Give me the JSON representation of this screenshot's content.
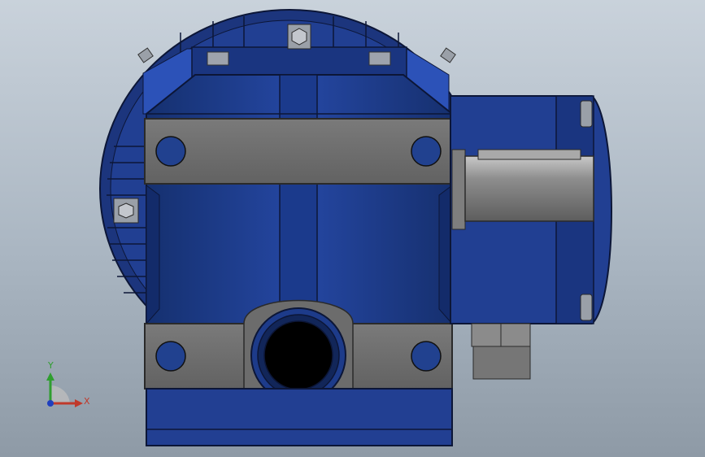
{
  "viewport": {
    "background_top": "#c9d2db",
    "background_bottom": "#8e9aa6"
  },
  "model": {
    "description_icon": "worm-gearbox-motor-icon",
    "body_color": "#1f3d8f",
    "body_dark": "#142a66",
    "flange_color": "#6f6f6f",
    "shaft_color": "#8a8a8a"
  },
  "triad": {
    "y_label": "Y",
    "x_label": "X",
    "y_color": "#2f9e2f",
    "x_color": "#c0392b",
    "z_color": "#1f3fbf"
  }
}
